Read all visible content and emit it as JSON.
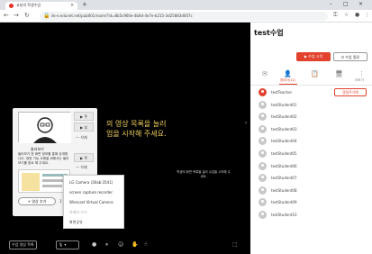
{
  "browser": {
    "tab_title": "교실의 학생수업",
    "tab_close": "×",
    "new_tab": "+",
    "url": "ds-e.edunet.net/pub001/room/?id=8b5c960e-4b6d-4e7e-b215-3d25883d007c",
    "win_min": "–",
    "win_max": "□",
    "win_close": "×"
  },
  "stage": {
    "message_line1": "의 영상 목록을 눌러",
    "message_line2": "업을 시작해 주세요.",
    "small_msg": "학생의 화면 목록을 눌러 수업을 시작해 주세요."
  },
  "panel": {
    "play1": "▶ 주",
    "play2": "▶ 부",
    "play3": "▶ 주",
    "delete1": "— 삭제",
    "delete2": "— 삭제",
    "title": "둘러보기",
    "desc": "둘러보기 한 화면 정보를 통해 공개합니다. 정한 기능 사용을 위해서는 둘러보기를 중요 해 주세요.",
    "add_label": "+ 영상 추가",
    "page": "1 / 5"
  },
  "menu": {
    "items": [
      "LG Camera (30ab:3541)",
      "screen capture recorder",
      "Wirecast Virtual Camera",
      "카메라 끄기",
      "화면공유"
    ]
  },
  "bottom": {
    "video_list": "수업 영상 목록"
  },
  "sidebar": {
    "title": "test수업",
    "start_btn": "▶ 수업 시작",
    "end_btn": "⏻ 수업 종료",
    "tabs": [
      {
        "icon": "✉",
        "label": "",
        "active": false
      },
      {
        "icon": "👤",
        "label": "참여자(11)",
        "active": true
      },
      {
        "icon": "📋",
        "label": "",
        "active": false
      },
      {
        "icon": "🖥",
        "label": "",
        "active": false
      },
      {
        "icon": "⋮",
        "label": "더보기",
        "active": false
      }
    ],
    "notice_btn": "알림주기해",
    "users": [
      {
        "name": "testTeacher",
        "teacher": true
      },
      {
        "name": "testStudent01",
        "teacher": false
      },
      {
        "name": "testStudent02",
        "teacher": false
      },
      {
        "name": "testStudent03",
        "teacher": false
      },
      {
        "name": "testStudent04",
        "teacher": false
      },
      {
        "name": "testStudent05",
        "teacher": false
      },
      {
        "name": "testStudent06",
        "teacher": false
      },
      {
        "name": "testStudent07",
        "teacher": false
      },
      {
        "name": "testStudent08",
        "teacher": false
      },
      {
        "name": "testStudent09",
        "teacher": false
      },
      {
        "name": "testStudent10",
        "teacher": false
      }
    ]
  },
  "colors": {
    "accent": "#e2412c",
    "stage_bg": "#000000",
    "highlight_text": "#f0d060"
  }
}
